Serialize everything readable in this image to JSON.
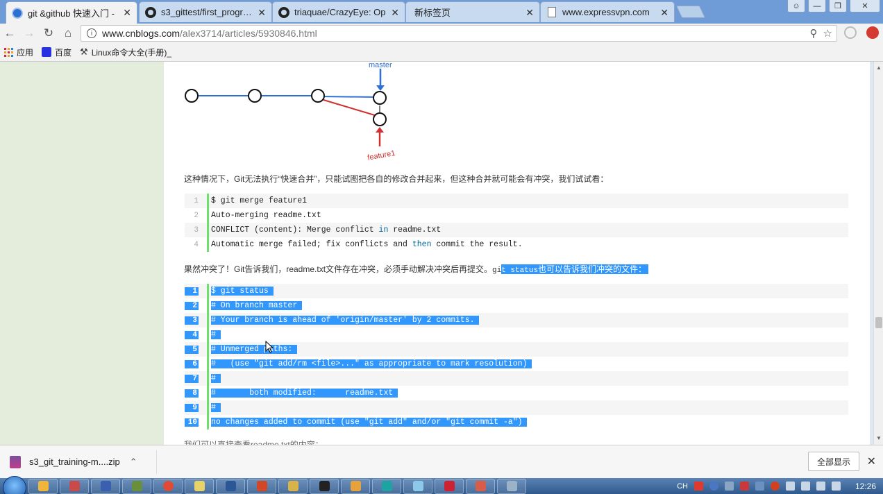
{
  "tabs": [
    {
      "title": "git &github 快速入门 -",
      "icon": "cnblogs-icon",
      "active": true
    },
    {
      "title": "s3_gittest/first_program",
      "icon": "github-icon"
    },
    {
      "title": "triaquae/CrazyEye: Op",
      "icon": "github-icon"
    },
    {
      "title": "新标签页",
      "icon": "none"
    },
    {
      "title": "www.expressvpn.com",
      "icon": "page-icon"
    }
  ],
  "omnibox": {
    "host": "www.cnblogs.com",
    "path": "/alex3714/articles/5930846.html"
  },
  "bookmarks": [
    {
      "label": "应用",
      "icon": "apps-grid-icon"
    },
    {
      "label": "百度",
      "icon": "baidu-paw-icon"
    },
    {
      "label": "Linux命令大全(手册)_",
      "icon": "linux-tool-icon"
    }
  ],
  "diagram": {
    "master_label": "master",
    "feature_label": "feature1",
    "colors": {
      "master": "#2c6fd6",
      "feature": "#d03030"
    }
  },
  "paragraph1": "这种情况下，Git无法执行“快速合并”，只能试图把各自的修改合并起来，但这种合并就可能会有冲突，我们试试看：",
  "code1": [
    {
      "n": "1",
      "text": "$ git merge feature1"
    },
    {
      "n": "2",
      "text": "Auto-merging readme.txt"
    },
    {
      "n": "3",
      "pre": "CONFLICT (content): Merge conflict ",
      "kw": "in",
      "post": " readme.txt"
    },
    {
      "n": "4",
      "pre": "Automatic merge failed; fix conflicts and ",
      "kw": "then",
      "post": " commit the result."
    }
  ],
  "paragraph2": {
    "before": "果然冲突了！Git告诉我们，readme.txt文件存在冲突，必须手动解决冲突后再提交。",
    "code_a": "gi",
    "code_b": "t status",
    "after": "也可以告诉我们冲突的文件："
  },
  "code2": [
    {
      "n": "1",
      "text": "$ git status "
    },
    {
      "n": "2",
      "text": "# On branch master "
    },
    {
      "n": "3",
      "text": "# Your branch is ahead of 'origin/master' by 2 commits. "
    },
    {
      "n": "4",
      "text": "# "
    },
    {
      "n": "5",
      "text": "# Unmerged paths: "
    },
    {
      "n": "6",
      "text": "#   (use \"git add/rm <file>...\" as appropriate to mark resolution) "
    },
    {
      "n": "7",
      "text": "# "
    },
    {
      "n": "8",
      "text": "#       both modified:      readme.txt "
    },
    {
      "n": "9",
      "text": "# "
    },
    {
      "n": "10",
      "text": "no changes added to commit (use \"git add\" and/or \"git commit -a\") "
    }
  ],
  "cut_text": "我们可以直接查看readme.txt的内容：",
  "download": {
    "filename": "s3_git_training-m....zip",
    "show_all": "全部显示"
  },
  "taskbar": {
    "tray_lang": "CH",
    "clock": "12:26"
  }
}
